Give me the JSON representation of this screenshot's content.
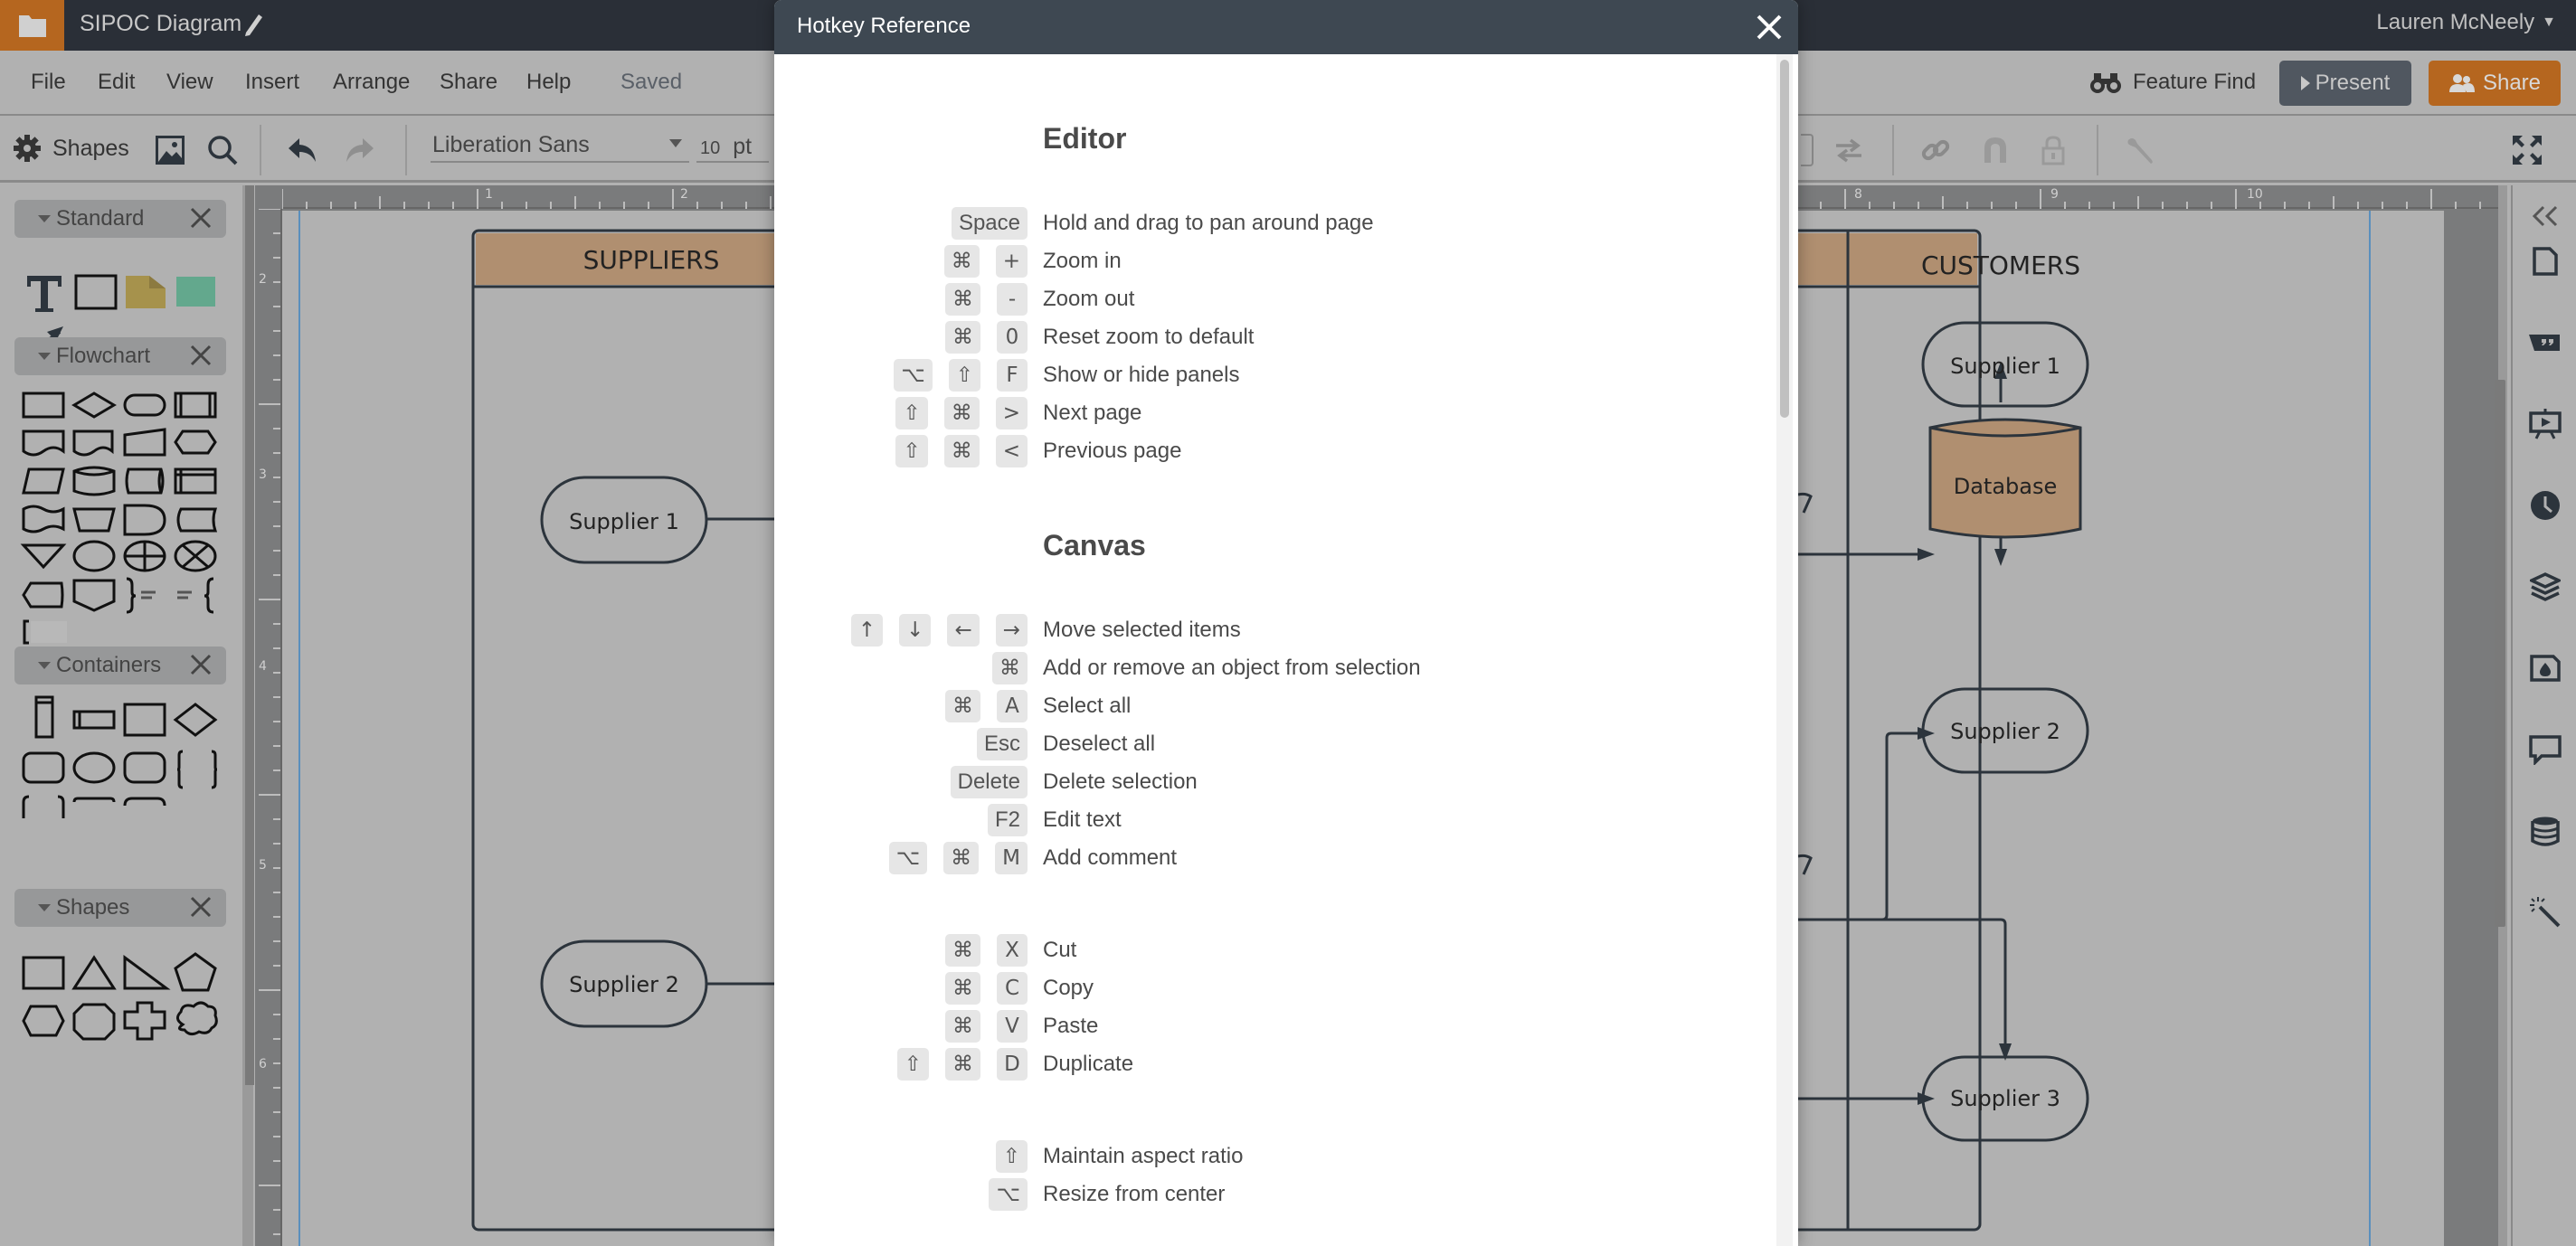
{
  "app": {
    "document_title": "SIPOC Diagram",
    "user_name": "Lauren McNeely"
  },
  "menu": {
    "items": [
      "File",
      "Edit",
      "View",
      "Insert",
      "Arrange",
      "Share",
      "Help"
    ],
    "status": "Saved",
    "feature_find": "Feature Find",
    "present_label": "Present",
    "share_label": "Share"
  },
  "toolbar": {
    "shapes_label": "Shapes",
    "font_family": "Liberation Sans",
    "font_size": "10",
    "font_size_unit": "pt"
  },
  "left_panel": {
    "libraries": [
      {
        "name": "Standard"
      },
      {
        "name": "Flowchart"
      },
      {
        "name": "Containers"
      },
      {
        "name": "Shapes"
      }
    ]
  },
  "canvas": {
    "ruler_h": [
      "1",
      "2",
      "8",
      "9",
      "10"
    ],
    "ruler_v": [
      "2",
      "3",
      "4",
      "5",
      "6"
    ],
    "swimlanes": [
      {
        "title": "SUPPLIERS"
      },
      {
        "title": "CUSTOMERS"
      }
    ],
    "nodes": {
      "left_supplier_1": "Supplier 1",
      "left_supplier_2": "Supplier 2",
      "right_supplier_1": "Supplier 1",
      "database": "Database",
      "right_supplier_2": "Supplier 2",
      "right_supplier_3": "Supplier 3"
    },
    "colors": {
      "lane_header": "#b08f70",
      "database_fill": "#b08f70",
      "stroke": "#2c343c"
    }
  },
  "right_rail": {
    "icons": [
      "collapse-icon",
      "page-icon",
      "quote-icon",
      "presentation-icon",
      "history-icon",
      "layers-icon",
      "image-icon",
      "comment-icon",
      "data-icon",
      "magic-wand-icon"
    ]
  },
  "modal": {
    "title": "Hotkey Reference",
    "sections": [
      {
        "title": "Editor",
        "rows": [
          {
            "keys": [
              "Space"
            ],
            "desc": "Hold and drag to pan around page"
          },
          {
            "keys": [
              "⌘",
              "+"
            ],
            "desc": "Zoom in"
          },
          {
            "keys": [
              "⌘",
              "-"
            ],
            "desc": "Zoom out"
          },
          {
            "keys": [
              "⌘",
              "0"
            ],
            "desc": "Reset zoom to default"
          },
          {
            "keys": [
              "⌥",
              "⇧",
              "F"
            ],
            "desc": "Show or hide panels"
          },
          {
            "keys": [
              "⇧",
              "⌘",
              ">"
            ],
            "desc": "Next page"
          },
          {
            "keys": [
              "⇧",
              "⌘",
              "<"
            ],
            "desc": "Previous page"
          }
        ]
      },
      {
        "title": "Canvas",
        "rows": [
          {
            "keys": [
              "↑",
              "↓",
              "←",
              "→"
            ],
            "desc": "Move selected items"
          },
          {
            "keys": [
              "⌘"
            ],
            "desc": "Add or remove an object from selection"
          },
          {
            "keys": [
              "⌘",
              "A"
            ],
            "desc": "Select all"
          },
          {
            "keys": [
              "Esc"
            ],
            "desc": "Deselect all"
          },
          {
            "keys": [
              "Delete"
            ],
            "desc": "Delete selection"
          },
          {
            "keys": [
              "F2"
            ],
            "desc": "Edit text"
          },
          {
            "keys": [
              "⌥",
              "⌘",
              "M"
            ],
            "desc": "Add comment"
          },
          {
            "keys": [
              "⌘",
              "X"
            ],
            "desc": "Cut"
          },
          {
            "keys": [
              "⌘",
              "C"
            ],
            "desc": "Copy"
          },
          {
            "keys": [
              "⌘",
              "V"
            ],
            "desc": "Paste"
          },
          {
            "keys": [
              "⇧",
              "⌘",
              "D"
            ],
            "desc": "Duplicate"
          },
          {
            "keys": [
              "⇧"
            ],
            "desc": "Maintain aspect ratio"
          },
          {
            "keys": [
              "⌥"
            ],
            "desc": "Resize from center"
          }
        ]
      }
    ]
  }
}
